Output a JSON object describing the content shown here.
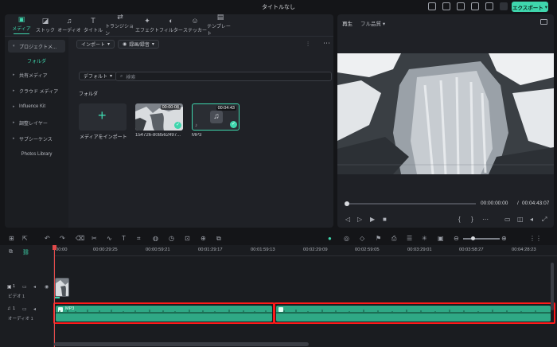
{
  "window": {
    "title": "タイトルなし",
    "export_label": "エクスポート"
  },
  "tabs": [
    {
      "label": "メディア",
      "icon": "media-icon",
      "active": true
    },
    {
      "label": "ストック",
      "icon": "stock-icon"
    },
    {
      "label": "オーディオ",
      "icon": "music-icon"
    },
    {
      "label": "タイトル",
      "icon": "title-icon"
    },
    {
      "label": "トランジション",
      "icon": "transition-icon"
    },
    {
      "label": "エフェクト",
      "icon": "effect-icon"
    },
    {
      "label": "フィルター",
      "icon": "filter-icon"
    },
    {
      "label": "ステッカー",
      "icon": "sticker-icon"
    },
    {
      "label": "テンプレート",
      "icon": "template-icon"
    }
  ],
  "sidebar": {
    "items": [
      {
        "label": "プロジェクトメ..."
      },
      {
        "label": "フォルダ"
      },
      {
        "label": "共有メディア"
      },
      {
        "label": "クラウド メディア"
      },
      {
        "label": "Influence Kit"
      },
      {
        "label": "調整レイヤー"
      },
      {
        "label": "サブシーケンス"
      },
      {
        "label": "Photos Library"
      }
    ]
  },
  "media": {
    "import_label": "インポート",
    "record_label": "録画/録音",
    "sort_label": "デフォルト",
    "search_placeholder": "検索",
    "folder_label": "フォルダ",
    "import_card_label": "メディアをインポート",
    "cards": [
      {
        "name": "154726-808562497...",
        "duration": "00:00:08"
      },
      {
        "name": "MP3",
        "duration": "00:04:43"
      }
    ]
  },
  "player": {
    "tab_label": "再生",
    "quality_label": "フル品質",
    "current_time": "00:00:00:00",
    "separator": "/",
    "total_time": "00:04:43:07"
  },
  "timeline": {
    "ruler": [
      "00:00",
      "00:00:29:25",
      "00:00:59:21",
      "00:01:29:17",
      "00:01:59:13",
      "00:02:29:09",
      "00:02:59:05",
      "00:03:29:01",
      "00:03:58:27",
      "00:04:28:23"
    ],
    "video_track_label": "ビデオ 1",
    "video_track_num": "1",
    "audio_track_label": "オーディオ 1",
    "audio_track_num": "1",
    "audio_clip_name": "MP3"
  },
  "colors": {
    "accent": "#3fd6ad",
    "highlight": "#ff1a1a",
    "playhead": "#e14a4a"
  }
}
